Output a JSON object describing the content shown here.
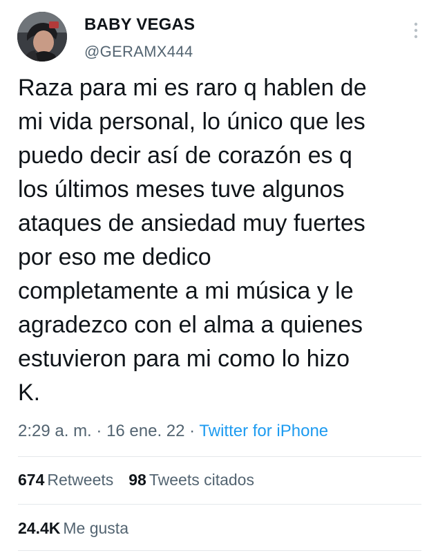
{
  "author": {
    "display_name": "BABY VEGAS",
    "handle": "@GERAMX444"
  },
  "tweet": {
    "text": "Raza para mi es raro q hablen de\nmi vida personal, lo único que les\npuedo decir así de corazón es q\nlos últimos meses tuve algunos\nataques de ansiedad muy fuertes\npor eso me dedico\ncompletamente a mi música y le\nagradezco con el alma a quienes\nestuvieron para mi como lo hizo\nK.",
    "time": "2:29 a. m.",
    "separator1": " · ",
    "date": "16 ene. 22",
    "separator2": " · ",
    "source": "Twitter for iPhone"
  },
  "stats": {
    "retweets_count": "674",
    "retweets_label": "Retweets",
    "quotes_count": "98",
    "quotes_label": "Tweets citados",
    "likes_count": "24.4K",
    "likes_label": "Me gusta"
  },
  "icons": {
    "more": "more-vertical-icon",
    "avatar": "avatar"
  },
  "colors": {
    "text": "#0f1419",
    "secondary": "#536471",
    "link": "#1d9bf0",
    "divider": "#e4e8eb"
  }
}
